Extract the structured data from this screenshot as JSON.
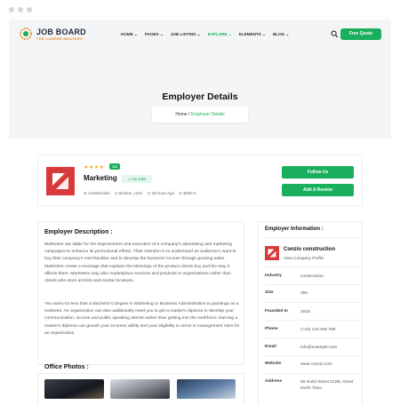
{
  "brand": {
    "title": "JOB BOARD",
    "subtitle": "THE CAREER MASTERS"
  },
  "nav": {
    "items": [
      {
        "label": "HOME ⌄",
        "active": false
      },
      {
        "label": "PAGES ⌄",
        "active": false
      },
      {
        "label": "JOB LISTING ⌄",
        "active": false
      },
      {
        "label": "EXPLORE ⌄",
        "active": true
      },
      {
        "label": "ELEMENTS ⌄",
        "active": false
      },
      {
        "label": "BLOG ⌄",
        "active": false
      }
    ],
    "cta": "Free Quote"
  },
  "hero": {
    "title": "Employer Details",
    "crumb_home": "Home",
    "crumb_sep": "/",
    "crumb_current": "Employer Details"
  },
  "company": {
    "stars": "★★★★",
    "rating": "4.6",
    "name": "Marketing",
    "jobs": "☺ 56 Jobs",
    "meta": [
      "⊘ construction",
      "⊙ Boston, USA",
      "◷ 19 Hour Ago",
      "≋ $250 K"
    ],
    "follow_label": "Follow Us",
    "review_label": "Add A Review"
  },
  "description": {
    "heading": "Employer Description :",
    "para1": "Marketers are liable for the improvement and execution of a company's advertising and marketing campaigns to enhance its promotional efforts. Their intention is to understand an audience's want to buy their company's merchandise and to develop the business' income through growing sales. Marketers create a message that explains the blessings of the product clients buy and the way it affects them. Marketers may also marketplace services and products to organizations rather than clients who store at brick-and-mortar locations.",
    "para2": "You want not less than a Bachelor's Degree in Marketing or Business Administration to paintings as a marketer. An organization can also additionally need you to get a master's diploma to develop your communication, income and public speaking talents earlier than getting into the workforce. Earning a master's diploma can growth your incomes ability and your eligibility to serve in management roles for an organization."
  },
  "photos": {
    "heading": "Office Photos :"
  },
  "employer_info": {
    "heading": "Employer Information :",
    "name": "Conzio construction",
    "link": "View Company Profile",
    "rows": [
      {
        "key": "Industry",
        "value": "construction"
      },
      {
        "key": "Size",
        "value": "350"
      },
      {
        "key": "Founded In",
        "value": "2018"
      },
      {
        "key": "Phone",
        "value": "(+44) 123 456 789"
      },
      {
        "key": "Email",
        "value": "info@example.com"
      },
      {
        "key": "Website",
        "value": "www.conzio.com"
      },
      {
        "key": "Address",
        "value": "66 Guild Street 512B, Great North Town."
      }
    ]
  },
  "colors": {
    "accent": "#1aaf5d",
    "brand_red": "#d8393a",
    "star": "#f5a623"
  }
}
